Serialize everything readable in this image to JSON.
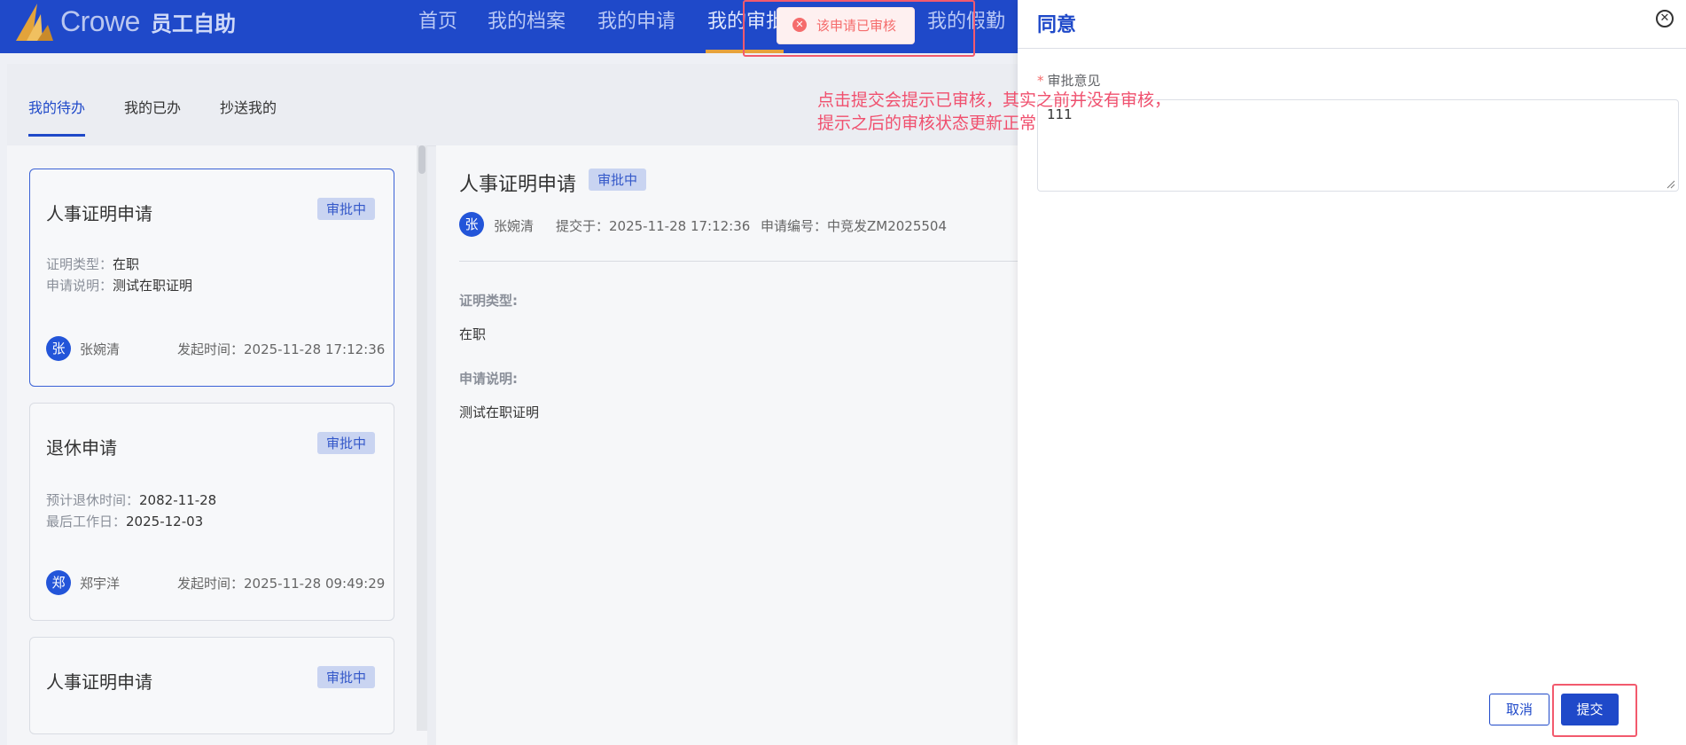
{
  "header": {
    "brand": "Crowe",
    "app_title": "员工自助",
    "nav": [
      "首页",
      "我的档案",
      "我的申请",
      "我的审批",
      "我的假勤"
    ],
    "active_nav": "我的审批"
  },
  "tabs": [
    "我的待办",
    "我的已办",
    "抄送我的"
  ],
  "cards": [
    {
      "title": "人事证明申请",
      "status": "审批中",
      "fields": [
        {
          "label": "证明类型：",
          "value": "在职"
        },
        {
          "label": "申请说明：",
          "value": "测试在职证明"
        }
      ],
      "avatar": "张",
      "person": "张婉清",
      "time": "发起时间：2025-11-28 17:12:36"
    },
    {
      "title": "退休申请",
      "status": "审批中",
      "fields": [
        {
          "label": "预计退休时间：",
          "value": "2082-11-28"
        },
        {
          "label": "最后工作日：",
          "value": "2025-12-03"
        }
      ],
      "avatar": "郑",
      "person": "郑宇洋",
      "time": "发起时间：2025-11-28 09:49:29"
    },
    {
      "title": "人事证明申请",
      "status": "审批中"
    }
  ],
  "detail": {
    "title": "人事证明申请",
    "status": "审批中",
    "avatar": "张",
    "person": "张婉清",
    "submitted": "提交于：2025-11-28 17:12:36",
    "request_no": "申请编号：中竞发ZM2025504",
    "fields": [
      {
        "label": "证明类型:",
        "value": "在职"
      },
      {
        "label": "申请说明:",
        "value": "测试在职证明"
      }
    ]
  },
  "toast": {
    "text": "该申请已审核",
    "type": "error",
    "icon": "error-circle-icon"
  },
  "annotation": {
    "line1": "点击提交会提示已审核，其实之前并没有审核，",
    "line2": "提示之后的审核状态更新正常"
  },
  "drawer": {
    "title": "同意",
    "field_label": "审批意见",
    "required_mark": "*",
    "textarea_value": "111",
    "cancel_label": "取消",
    "submit_label": "提交"
  },
  "colors": {
    "primary": "#1f49c9",
    "accent_underline": "#e6a23c",
    "error": "#f56c6c",
    "annotation": "#f0506e"
  }
}
